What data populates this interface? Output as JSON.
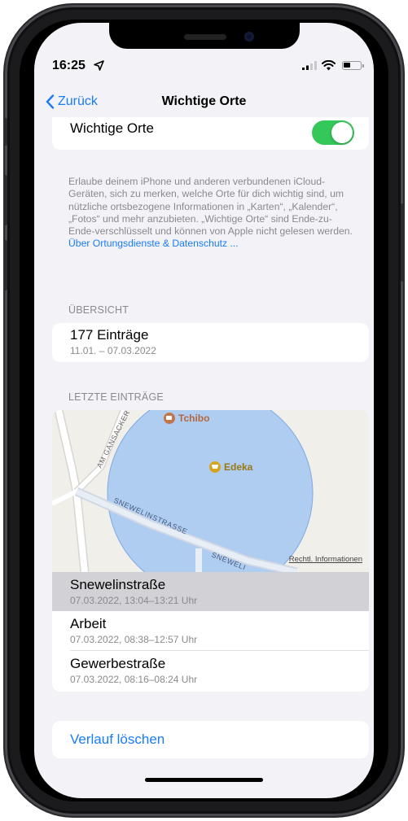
{
  "status_bar": {
    "time": "16:25"
  },
  "nav": {
    "back_label": "Zurück",
    "title": "Wichtige Orte"
  },
  "toggle": {
    "label": "Wichtige Orte",
    "on": true
  },
  "description": {
    "text": "Erlaube deinem iPhone und anderen verbundenen iCloud-Geräten, sich zu merken, welche Orte für dich wichtig sind, um nützliche ortsbezogene Informationen in „Karten“, „Kalender“, „Fotos“ und mehr anzubieten. „Wichtige Orte“ sind Ende-zu-Ende-verschlüsselt und können von Apple nicht gelesen werden.",
    "link": "Über Ortungsdienste & Datenschutz ..."
  },
  "overview": {
    "header": "ÜBERSICHT",
    "title": "177 Einträge",
    "range": "11.01. – 07.03.2022"
  },
  "recent": {
    "header": "LETZTE EINTRÄGE",
    "map": {
      "pois": [
        {
          "name": "Tchibo",
          "icon": "coffee-icon"
        },
        {
          "name": "Edeka",
          "icon": "shopping-cart-icon"
        }
      ],
      "streets": [
        "AM GANSACKER",
        "SNEWELINSTRASSE",
        "SNEWELI"
      ],
      "legal": "Rechtl. Informationen"
    },
    "visits": [
      {
        "name": "Snewelinstraße",
        "time": "07.03.2022, 13:04–13:21 Uhr",
        "selected": true
      },
      {
        "name": "Arbeit",
        "time": "07.03.2022, 08:38–12:57 Uhr",
        "selected": false
      },
      {
        "name": "Gewerbestraße",
        "time": "07.03.2022, 08:16–08:24 Uhr",
        "selected": false
      }
    ]
  },
  "actions": {
    "clear_history": "Verlauf löschen"
  },
  "colors": {
    "accent": "#1a7cf5",
    "toggle_on": "#34c759",
    "region": "#a7c8f2",
    "background": "#f2f2f7"
  }
}
